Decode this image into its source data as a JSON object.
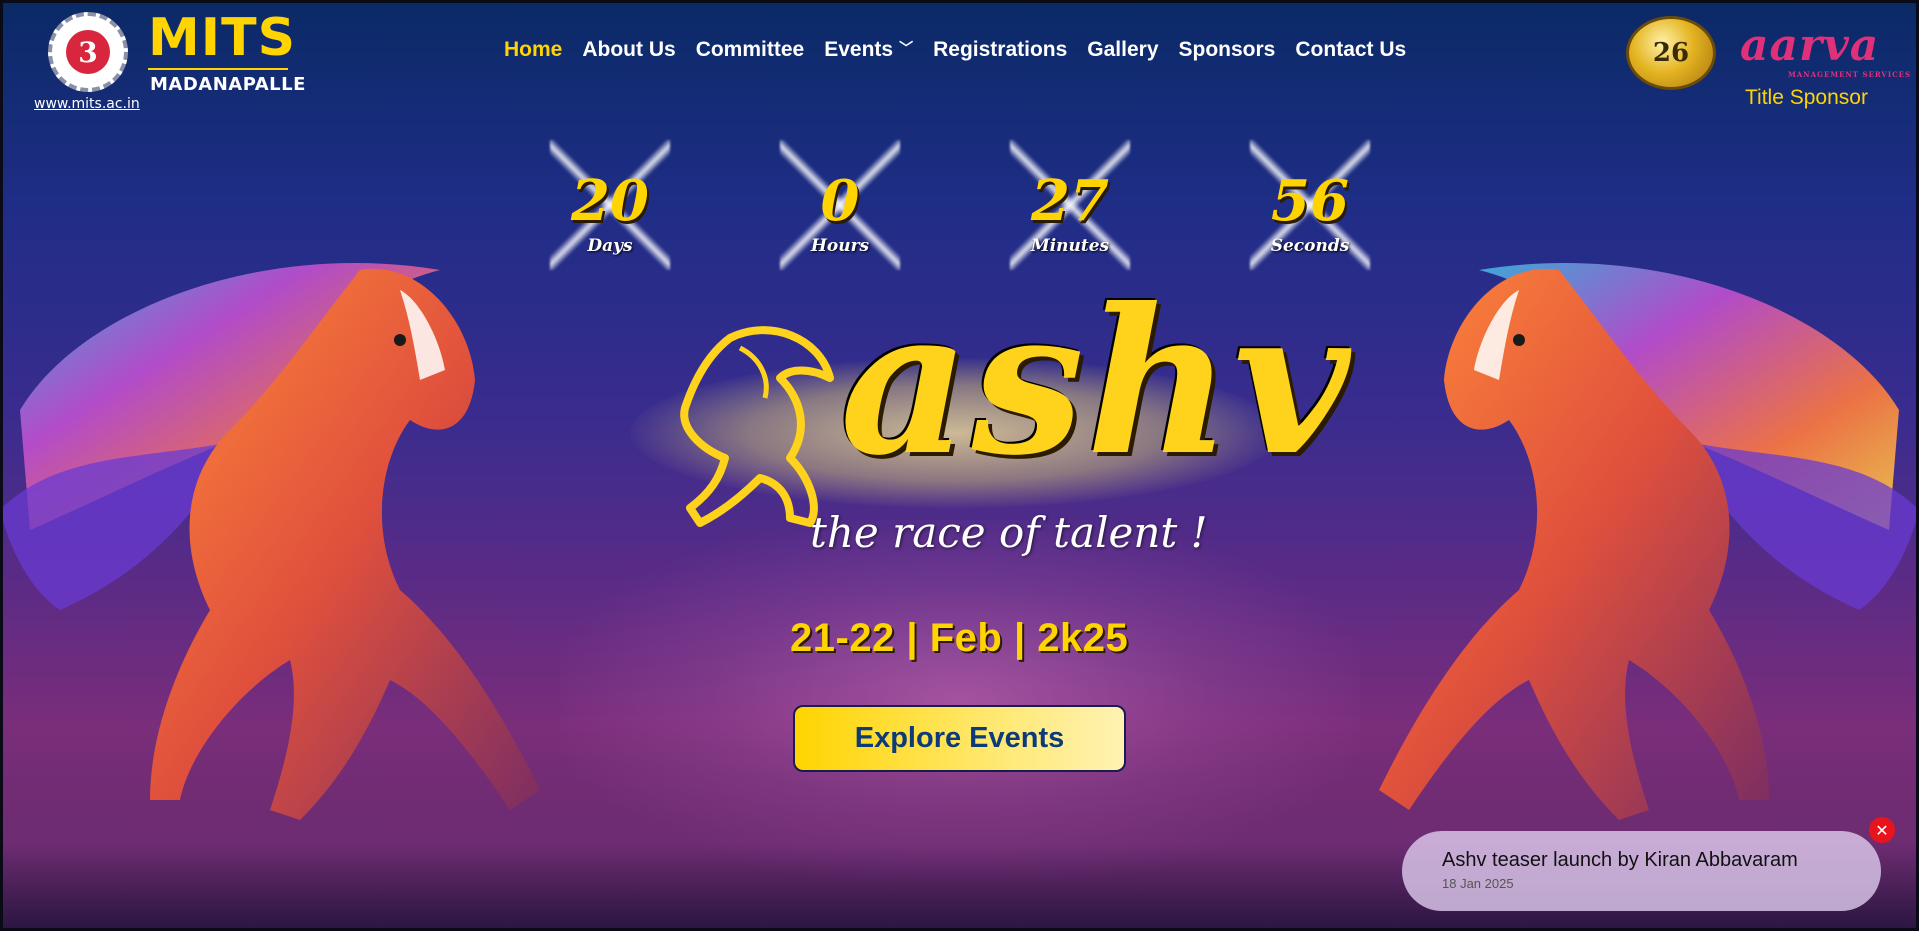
{
  "header": {
    "brand": {
      "name": "MITS",
      "subtitle": "MADANAPALLE",
      "url": "www.mits.ac.in",
      "emblem_glyph": "3",
      "brand_color": "#ffd400"
    },
    "nav": {
      "items": [
        {
          "label": "Home",
          "active": true
        },
        {
          "label": "About Us",
          "active": false
        },
        {
          "label": "Committee",
          "active": false
        },
        {
          "label": "Events",
          "active": false,
          "dropdown": true
        },
        {
          "label": "Registrations",
          "active": false
        },
        {
          "label": "Gallery",
          "active": false
        },
        {
          "label": "Sponsors",
          "active": false
        },
        {
          "label": "Contact Us",
          "active": false
        }
      ],
      "active_color": "#ffd400"
    },
    "badge_number": "26",
    "sponsor": {
      "logo_text": "aarva",
      "logo_subtext": "MANAGEMENT SERVICES",
      "label": "Title Sponsor"
    }
  },
  "countdown": [
    {
      "value": "20",
      "unit": "Days"
    },
    {
      "value": "0",
      "unit": "Hours"
    },
    {
      "value": "27",
      "unit": "Minutes"
    },
    {
      "value": "56",
      "unit": "Seconds"
    }
  ],
  "hero": {
    "event_name": "ashv",
    "tagline": "the race of talent !",
    "dates": "21-22 | Feb | 2k25",
    "cta_label": "Explore Events"
  },
  "notification": {
    "title": "Ashv teaser launch by Kiran Abbavaram",
    "date": "18 Jan 2025",
    "close_icon": "close-icon"
  }
}
